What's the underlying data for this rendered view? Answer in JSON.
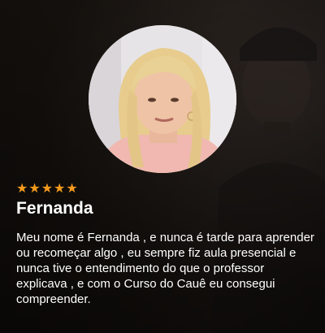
{
  "testimonial": {
    "rating": 5,
    "stars_text": "★★★★★",
    "name": "Fernanda",
    "quote": "Meu nome é Fernanda , e nunca é tarde para aprender ou recomeçar algo , eu sempre fiz aula presencial e nunca tive o entendimento do que o professor explicava , e com o Curso do Cauê eu consegui compreender."
  },
  "colors": {
    "star": "#f39a1c",
    "text": "#ffffff",
    "background": "#15110e"
  }
}
